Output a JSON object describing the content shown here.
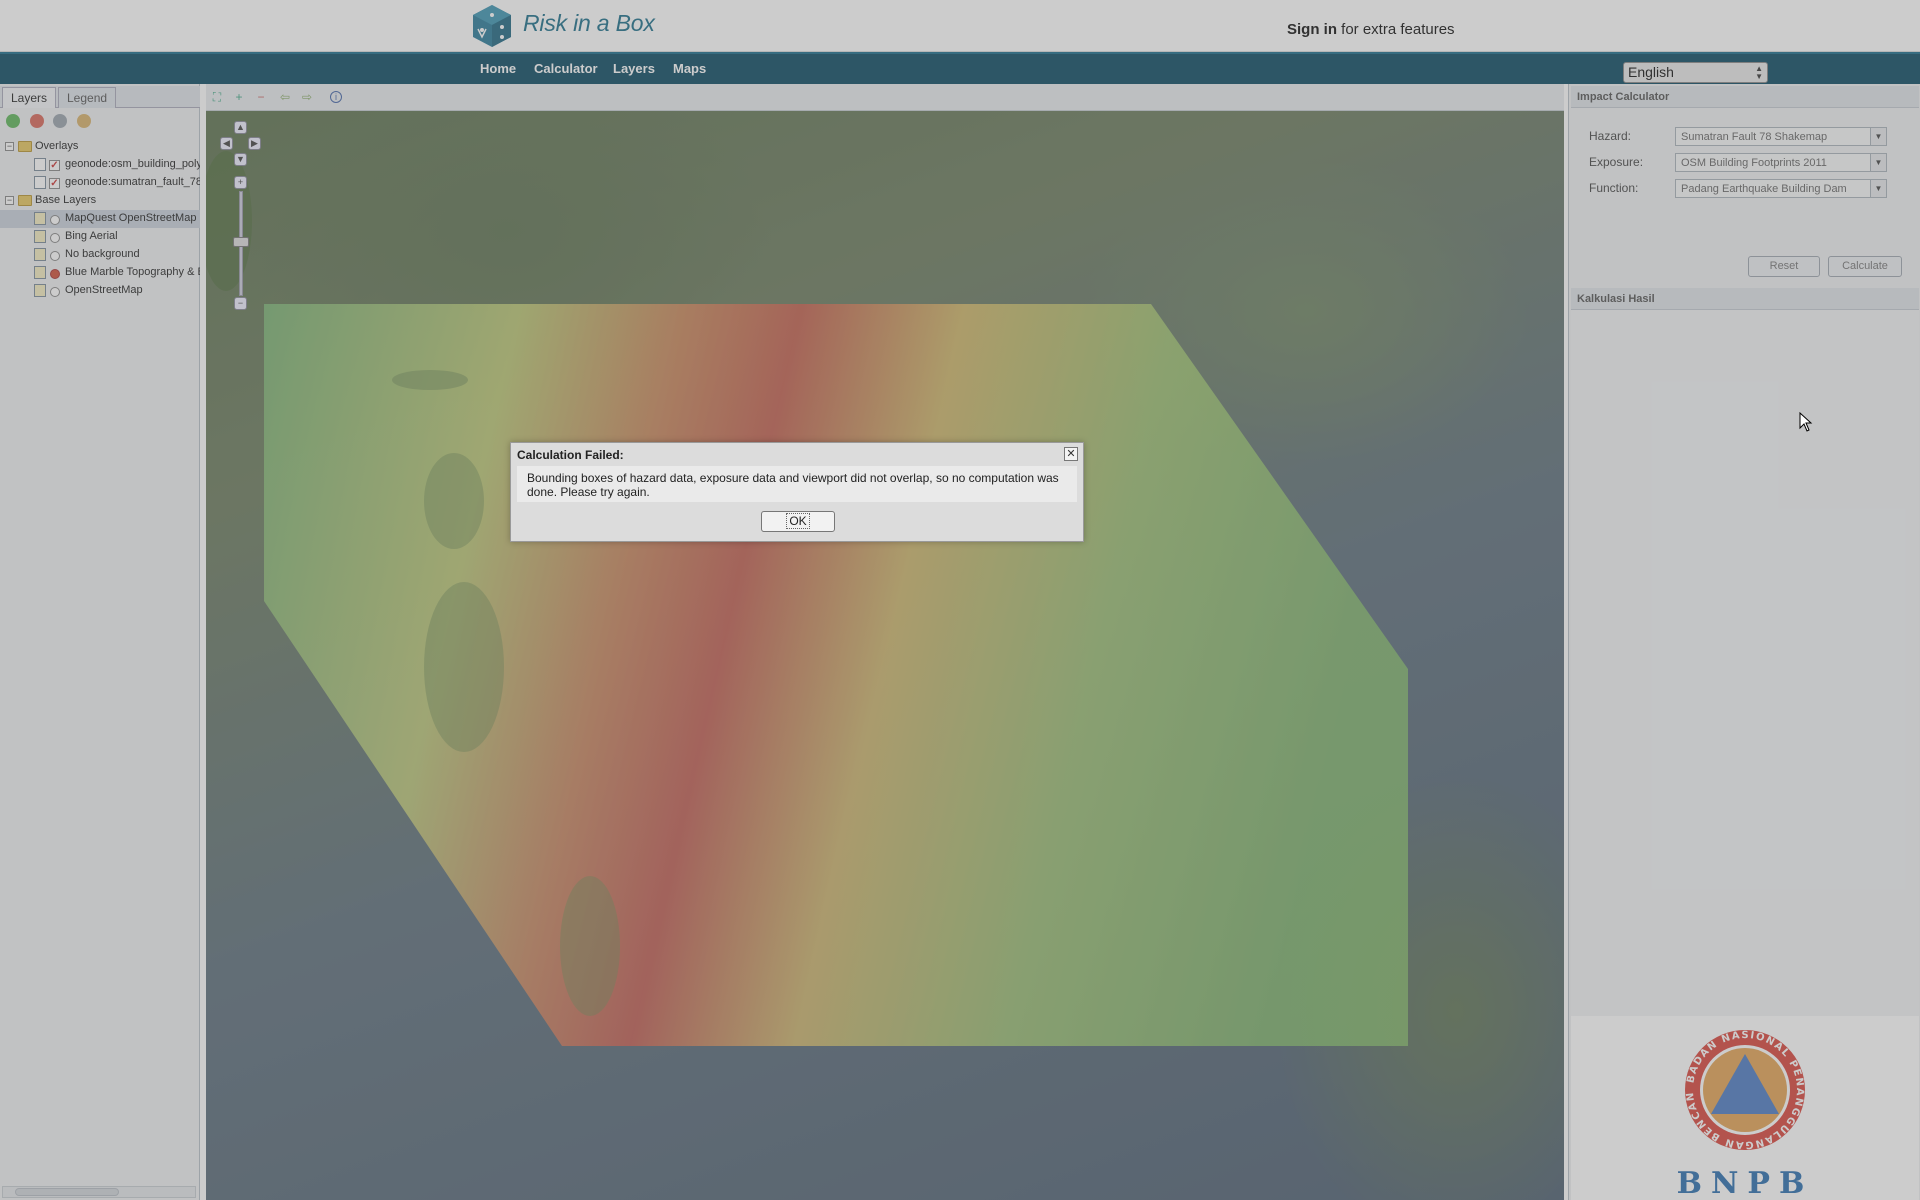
{
  "header": {
    "brand": "Risk in a Box",
    "signin_bold": "Sign in",
    "signin_rest": " for extra features"
  },
  "nav": {
    "items": [
      "Home",
      "Calculator",
      "Layers",
      "Maps"
    ],
    "language": "English"
  },
  "left_panel": {
    "tabs": [
      "Layers",
      "Legend"
    ],
    "tree": [
      {
        "label": "Overlays"
      },
      {
        "label": "geonode:osm_building_poly"
      },
      {
        "label": "geonode:sumatran_fault_78"
      },
      {
        "label": "Base Layers"
      },
      {
        "label": "MapQuest OpenStreetMap"
      },
      {
        "label": "Bing Aerial"
      },
      {
        "label": "No background"
      },
      {
        "label": "Blue Marble Topography & B"
      },
      {
        "label": "OpenStreetMap"
      }
    ]
  },
  "impact_calculator": {
    "title": "Impact Calculator",
    "hazard_label": "Hazard:",
    "hazard_value": "Sumatran Fault 78 Shakemap",
    "exposure_label": "Exposure:",
    "exposure_value": "OSM Building Footprints 2011",
    "function_label": "Function:",
    "function_value": "Padang Earthquake Building Dam",
    "reset_label": "Reset",
    "calculate_label": "Calculate"
  },
  "results": {
    "title": "Kalkulasi Hasil"
  },
  "bnpb": {
    "text": "BNPB",
    "ring_text": "BADAN NASIONAL PENANGGULANGAN BENCANA",
    "colors": {
      "ring": "#d9453c",
      "triangle": "#4d7cc4",
      "disk": "#e3a355"
    }
  },
  "dialog": {
    "title": "Calculation Failed:",
    "message": "Bounding boxes of hazard data, exposure data and viewport did not overlap, so no computation was done. Please try again.",
    "ok_label": "OK"
  },
  "colors": {
    "nav_bg": "#0c4a63",
    "brand": "#1d6f8a"
  }
}
